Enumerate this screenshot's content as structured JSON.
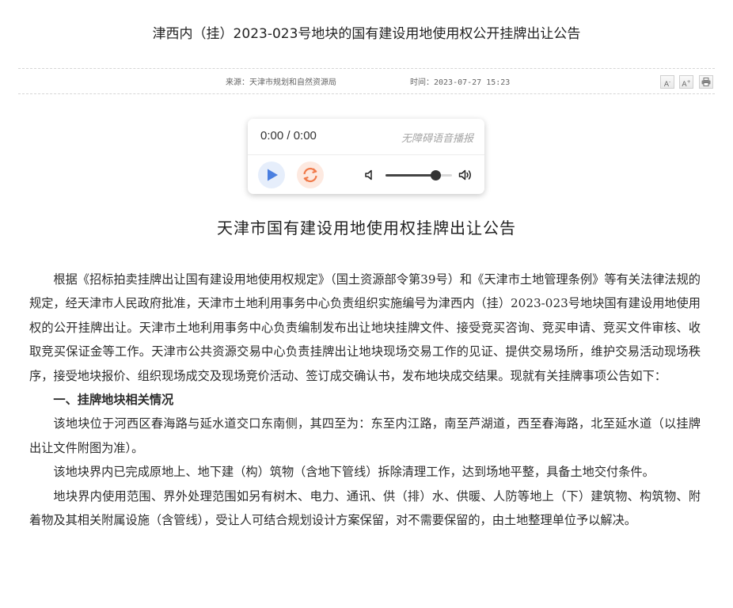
{
  "page": {
    "title": "津西内（挂）2023-023号地块的国有建设用地使用权公开挂牌出让公告"
  },
  "meta": {
    "source": "来源：天津市规划和自然资源局",
    "time_label": "时间：",
    "time_value": "2023-07-27 15:23"
  },
  "toolbar": {
    "font_decrease": "A",
    "font_decrease_sup": "-",
    "font_increase": "A",
    "font_increase_sup": "+",
    "print_icon": "print-icon"
  },
  "audio": {
    "time": "0:00 / 0:00",
    "caption": "无障碍语音播报",
    "volume": 0.75,
    "colors": {
      "play": "#4a7fe0",
      "replay": "#f07a4a"
    }
  },
  "document": {
    "heading": "天津市国有建设用地使用权挂牌出让公告",
    "intro": "根据《招标拍卖挂牌出让国有建设用地使用权规定》（国土资源部令第39号）和《天津市土地管理条例》等有关法律法规的规定，经天津市人民政府批准，天津市土地利用事务中心负责组织实施编号为津西内（挂）2023-023号地块国有建设用地使用权的公开挂牌出让。天津市土地利用事务中心负责编制发布出让地块挂牌文件、接受竞买咨询、竞买申请、竞买文件审核、收取竞买保证金等工作。天津市公共资源交易中心负责挂牌出让地块现场交易工作的见证、提供交易场所，维护交易活动现场秩序，接受地块报价、组织现场成交及现场竞价活动、签订成交确认书，发布地块成交结果。现就有关挂牌事项公告如下：",
    "section1_title": "一、挂牌地块相关情况",
    "para1": "该地块位于河西区春海路与延水道交口东南侧，其四至为：东至内江路，南至芦湖道，西至春海路，北至延水道（以挂牌出让文件附图为准）。",
    "para2": "该地块界内已完成原地上、地下建（构）筑物（含地下管线）拆除清理工作，达到场地平整，具备土地交付条件。",
    "para3": "地块界内使用范围、界外处理范围如另有树木、电力、通讯、供（排）水、供暖、人防等地上（下）建筑物、构筑物、附着物及其相关附属设施（含管线），受让人可结合规划设计方案保留，对不需要保留的，由土地整理单位予以解决。"
  }
}
